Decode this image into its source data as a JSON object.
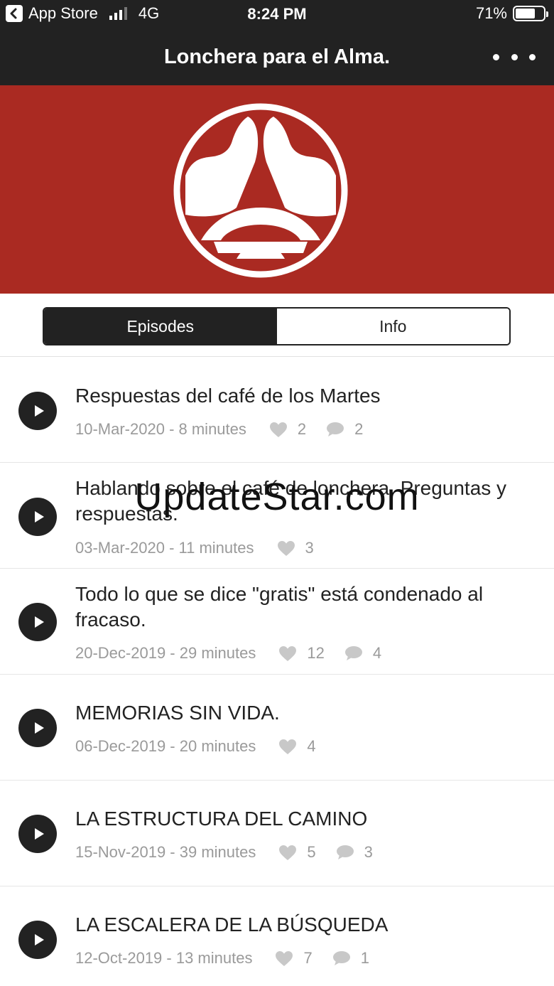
{
  "status_bar": {
    "back_app": "App Store",
    "network": "4G",
    "time": "8:24 PM",
    "battery": "71%",
    "battery_level": 0.71
  },
  "nav": {
    "title": "Lonchera para el Alma."
  },
  "tabs": [
    {
      "label": "Episodes",
      "active": true
    },
    {
      "label": "Info",
      "active": false
    }
  ],
  "episodes": [
    {
      "title": "Respuestas del café de los Martes",
      "meta": "10-Mar-2020 - 8 minutes",
      "likes": "2",
      "comments": "2"
    },
    {
      "title": "Hablando sobre el café de lonchera. Preguntas y respuestas.",
      "meta": "03-Mar-2020 - 11 minutes",
      "likes": "3"
    },
    {
      "title": "Todo lo que se dice \"gratis\" está condenado al fracaso.",
      "meta": "20-Dec-2019 - 29 minutes",
      "likes": "12",
      "comments": "4"
    },
    {
      "title": "MEMORIAS SIN VIDA.",
      "meta": "06-Dec-2019 - 20 minutes",
      "likes": "4"
    },
    {
      "title": "LA ESTRUCTURA DEL CAMINO",
      "meta": "15-Nov-2019 - 39 minutes",
      "likes": "5",
      "comments": "3"
    },
    {
      "title": "LA ESCALERA DE LA BÚSQUEDA",
      "meta": "12-Oct-2019 - 13 minutes",
      "likes": "7",
      "comments": "1"
    }
  ],
  "watermark": "UpdateStar.com",
  "colors": {
    "bar": "#222222",
    "hero": "#aa2a22",
    "meta_text": "#9a9a9a"
  },
  "icons": {
    "play": "play-icon",
    "like": "heart-icon",
    "comment": "comment-icon",
    "more": "more-icon",
    "back": "back-chevron-icon"
  }
}
